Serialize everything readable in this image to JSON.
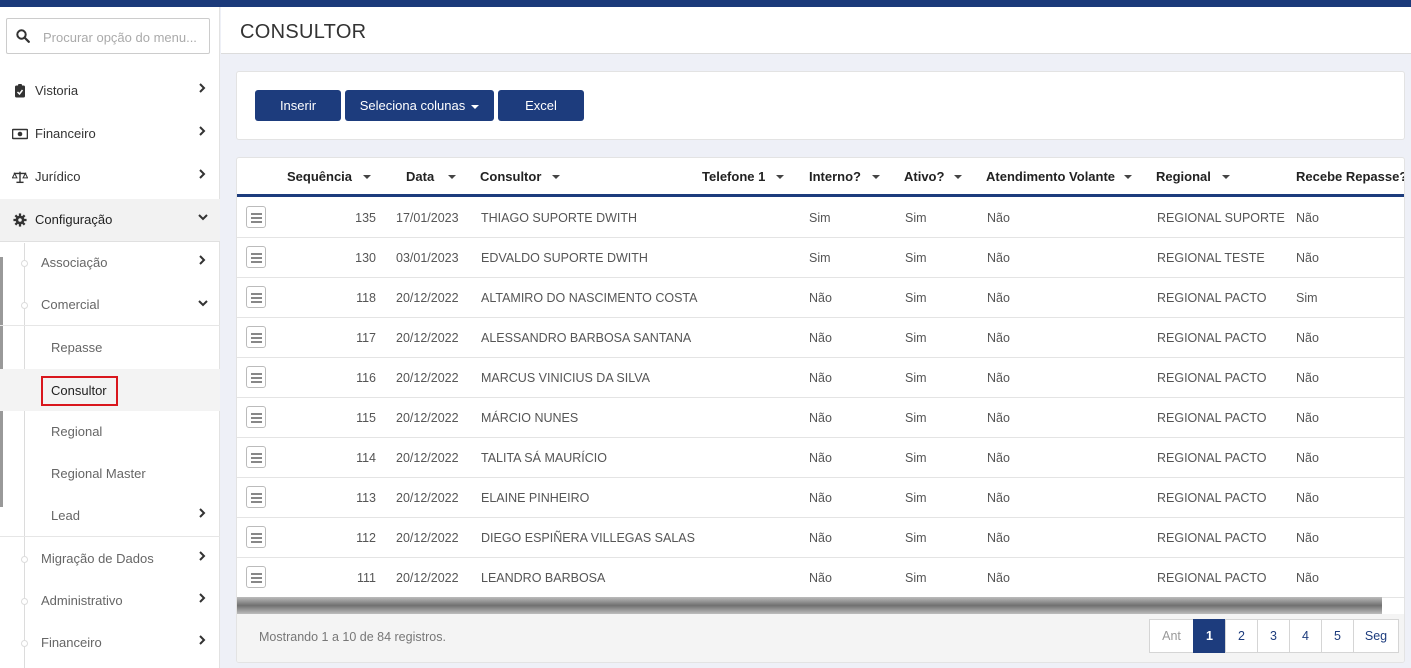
{
  "search": {
    "placeholder": "Procurar opção do menu..."
  },
  "sidebar": {
    "items": [
      {
        "label": "Vistoria",
        "icon": "clipboard-check-icon"
      },
      {
        "label": "Financeiro",
        "icon": "money-bill-icon"
      },
      {
        "label": "Jurídico",
        "icon": "balance-scale-icon"
      },
      {
        "label": "Configuração",
        "icon": "gear-icon"
      }
    ],
    "config_children": [
      {
        "label": "Associação"
      },
      {
        "label": "Comercial"
      }
    ],
    "comercial_children": [
      {
        "label": "Repasse"
      },
      {
        "label": "Consultor"
      },
      {
        "label": "Regional"
      },
      {
        "label": "Regional Master"
      },
      {
        "label": "Lead"
      }
    ],
    "config_children_after": [
      {
        "label": "Migração de Dados"
      },
      {
        "label": "Administrativo"
      },
      {
        "label": "Financeiro"
      }
    ]
  },
  "page": {
    "title": "CONSULTOR"
  },
  "toolbar": {
    "insert_label": "Inserir",
    "columns_label": "Seleciona colunas",
    "excel_label": "Excel"
  },
  "table": {
    "headers": {
      "sequencia": "Sequência",
      "data": "Data",
      "consultor": "Consultor",
      "telefone": "Telefone 1",
      "interno": "Interno?",
      "ativo": "Ativo?",
      "atendimento": "Atendimento Volante",
      "regional": "Regional",
      "repasse": "Recebe Repasse?"
    },
    "rows": [
      {
        "seq": "135",
        "data": "17/01/2023",
        "consultor": "THIAGO SUPORTE DWITH",
        "telefone": "",
        "interno": "Sim",
        "ativo": "Sim",
        "atendimento": "Não",
        "regional": "REGIONAL SUPORTE",
        "repasse": "Não"
      },
      {
        "seq": "130",
        "data": "03/01/2023",
        "consultor": "EDVALDO SUPORTE DWITH",
        "telefone": "",
        "interno": "Sim",
        "ativo": "Sim",
        "atendimento": "Não",
        "regional": "REGIONAL TESTE",
        "repasse": "Não"
      },
      {
        "seq": "118",
        "data": "20/12/2022",
        "consultor": "ALTAMIRO DO NASCIMENTO COSTA",
        "telefone": "",
        "interno": "Não",
        "ativo": "Sim",
        "atendimento": "Não",
        "regional": "REGIONAL PACTO",
        "repasse": "Sim"
      },
      {
        "seq": "117",
        "data": "20/12/2022",
        "consultor": "ALESSANDRO BARBOSA SANTANA",
        "telefone": "",
        "interno": "Não",
        "ativo": "Sim",
        "atendimento": "Não",
        "regional": "REGIONAL PACTO",
        "repasse": "Não"
      },
      {
        "seq": "116",
        "data": "20/12/2022",
        "consultor": "MARCUS VINICIUS DA SILVA",
        "telefone": "",
        "interno": "Não",
        "ativo": "Sim",
        "atendimento": "Não",
        "regional": "REGIONAL PACTO",
        "repasse": "Não"
      },
      {
        "seq": "115",
        "data": "20/12/2022",
        "consultor": "MÁRCIO NUNES",
        "telefone": "",
        "interno": "Não",
        "ativo": "Sim",
        "atendimento": "Não",
        "regional": "REGIONAL PACTO",
        "repasse": "Não"
      },
      {
        "seq": "114",
        "data": "20/12/2022",
        "consultor": "TALITA SÁ MAURÍCIO",
        "telefone": "",
        "interno": "Não",
        "ativo": "Sim",
        "atendimento": "Não",
        "regional": "REGIONAL PACTO",
        "repasse": "Não"
      },
      {
        "seq": "113",
        "data": "20/12/2022",
        "consultor": "ELAINE PINHEIRO",
        "telefone": "",
        "interno": "Não",
        "ativo": "Sim",
        "atendimento": "Não",
        "regional": "REGIONAL PACTO",
        "repasse": "Não"
      },
      {
        "seq": "112",
        "data": "20/12/2022",
        "consultor": "DIEGO ESPIÑERA VILLEGAS SALAS",
        "telefone": "",
        "interno": "Não",
        "ativo": "Sim",
        "atendimento": "Não",
        "regional": "REGIONAL PACTO",
        "repasse": "Não"
      },
      {
        "seq": "111",
        "data": "20/12/2022",
        "consultor": "LEANDRO BARBOSA",
        "telefone": "",
        "interno": "Não",
        "ativo": "Sim",
        "atendimento": "Não",
        "regional": "REGIONAL PACTO",
        "repasse": "Não"
      }
    ],
    "footer": {
      "showing": "Mostrando 1 a 10 de 84 registros."
    }
  },
  "pagination": {
    "prev": "Ant",
    "pages": [
      "1",
      "2",
      "3",
      "4",
      "5"
    ],
    "next": "Seg",
    "current": "1"
  },
  "colors": {
    "brand": "#1d3c7d",
    "highlight": "#d9161d"
  }
}
